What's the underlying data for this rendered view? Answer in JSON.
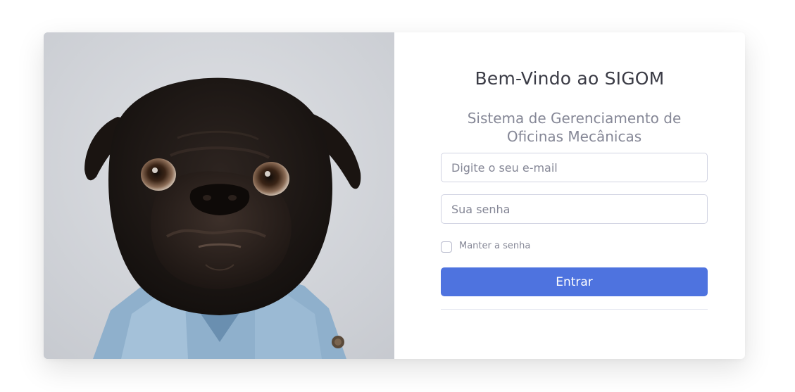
{
  "login": {
    "title": "Bem-Vindo ao SIGOM",
    "subtitle": "Sistema de Gerenciamento de Oficinas Mecânicas",
    "email_placeholder": "Digite o seu e-mail",
    "password_placeholder": "Sua senha",
    "remember_label": "Manter a senha",
    "submit_label": "Entrar"
  },
  "image": {
    "subject": "pug wearing denim jacket"
  },
  "colors": {
    "primary": "#4e73df",
    "title_text": "#3a3b45",
    "muted_text": "#858796",
    "input_border": "#d1d3e2"
  }
}
